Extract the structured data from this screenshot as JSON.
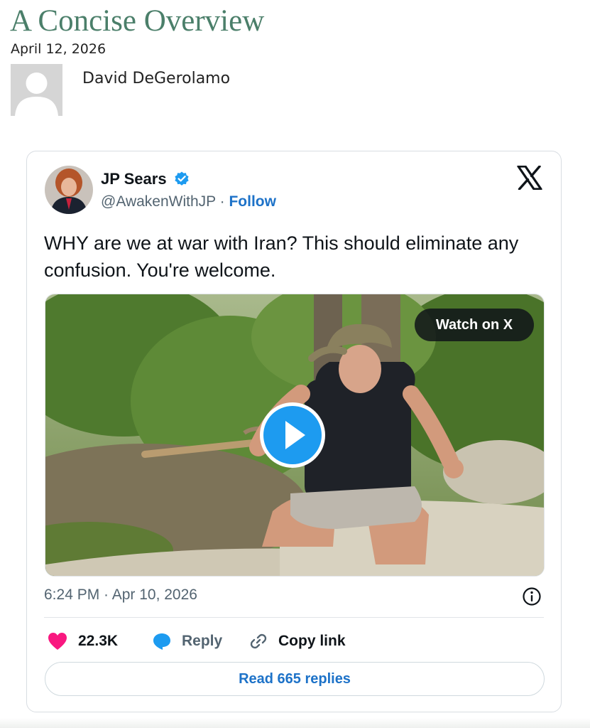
{
  "article": {
    "title": "A Concise Overview",
    "date": "April 12, 2026",
    "author": "David DeGerolamo"
  },
  "tweet": {
    "name": "JP Sears",
    "handle": "@AwakenWithJP",
    "separator": "·",
    "follow_label": "Follow",
    "text": "WHY are we at war with Iran? This should eliminate any confusion. You're welcome.",
    "watch_label": "Watch on X",
    "timestamp": "6:24 PM · Apr 10, 2026",
    "likes": "22.3K",
    "reply_label": "Reply",
    "copy_link_label": "Copy link",
    "read_replies_label": "Read 665 replies"
  },
  "icons": {
    "verified": "verified-badge-icon",
    "x_logo": "x-logo-icon",
    "play": "play-icon",
    "info": "info-icon",
    "like": "heart-icon",
    "reply": "speech-bubble-icon",
    "copy": "link-icon"
  },
  "colors": {
    "title_green": "#4b7f6a",
    "link_blue": "#1d72c8",
    "like_pink": "#f91880",
    "verified_blue": "#1d9bf0",
    "play_blue": "#1d9bf0"
  }
}
